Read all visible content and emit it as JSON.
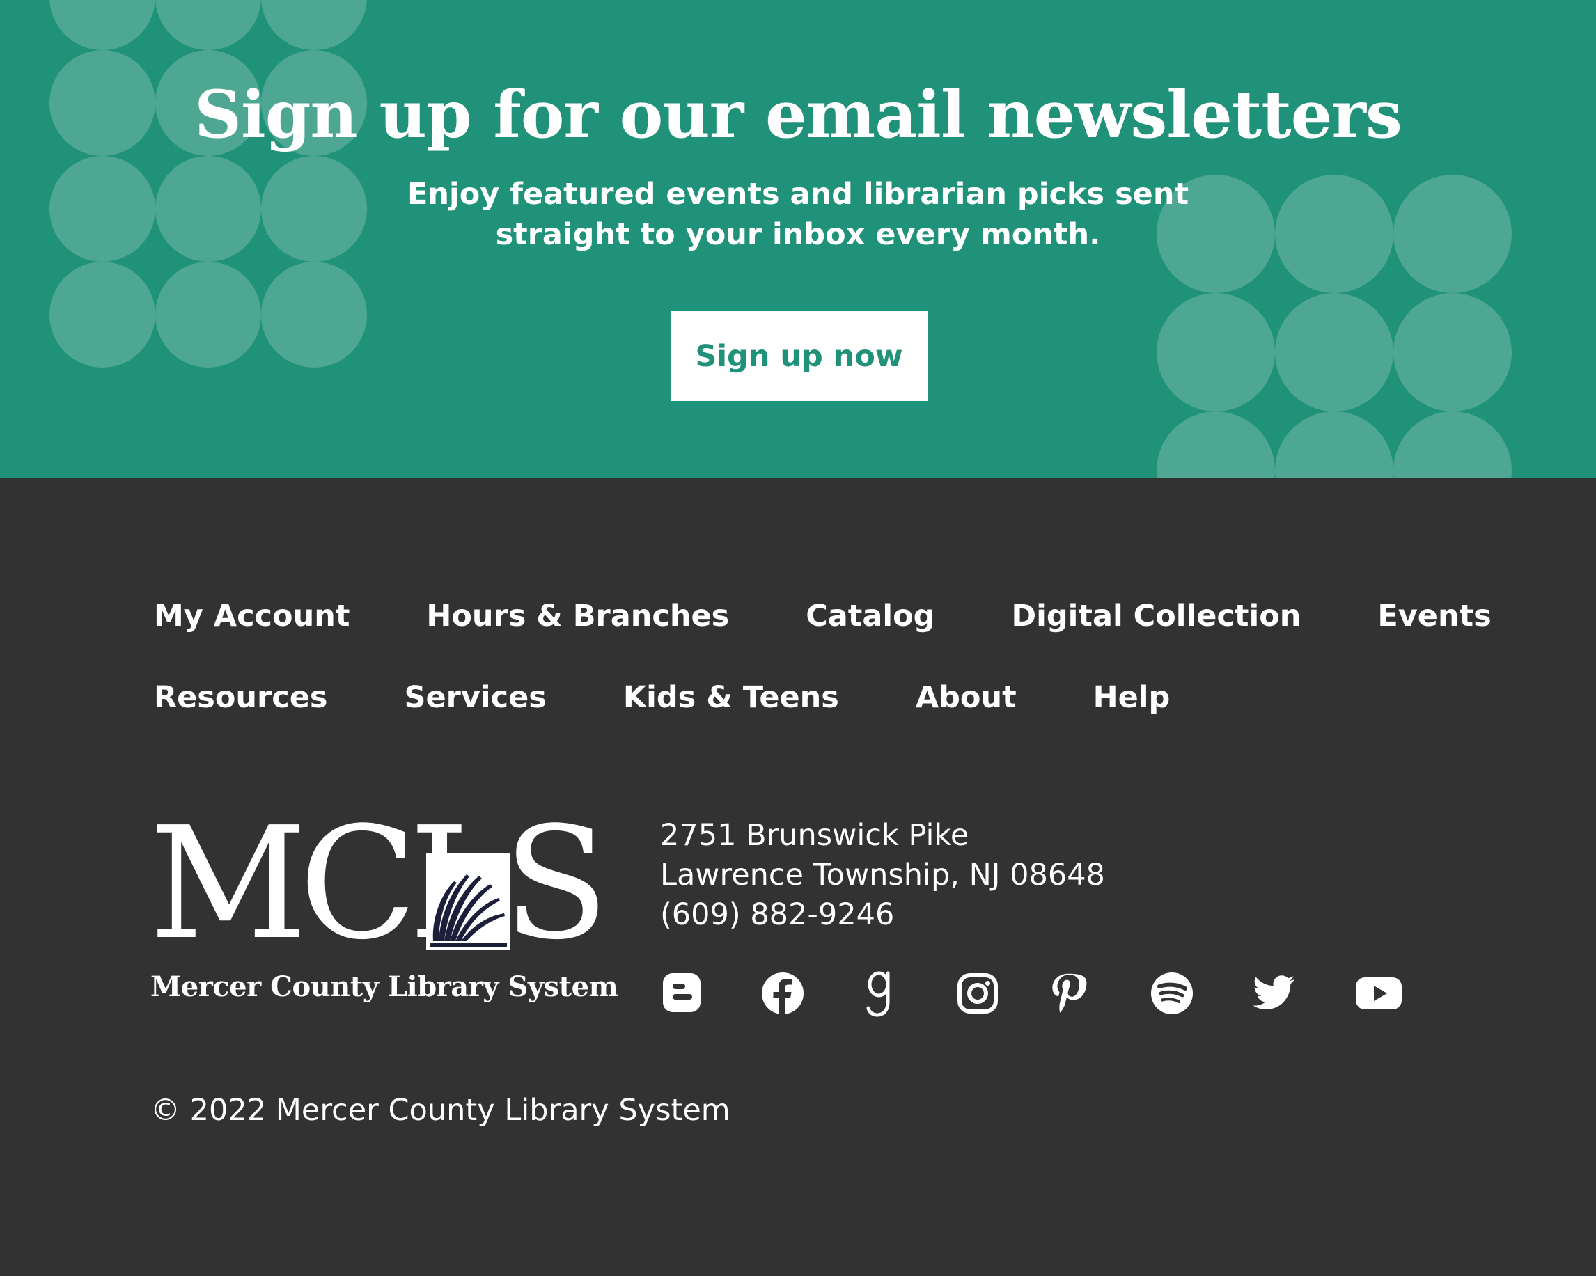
{
  "newsletter": {
    "title": "Sign up for our email newsletters",
    "subtitle_line1": "Enjoy featured events and librarian picks sent",
    "subtitle_line2": "straight to your inbox every month.",
    "button_label": "Sign up now",
    "background_color": "#21927a",
    "dot_color": "#4ea792"
  },
  "footer": {
    "background_color": "#323232",
    "nav_row1": [
      "My Account",
      "Hours & Branches",
      "Catalog",
      "Digital Collection",
      "Events"
    ],
    "nav_row2": [
      "Resources",
      "Services",
      "Kids & Teens",
      "About",
      "Help"
    ],
    "logo": {
      "letters": "MCLS",
      "tagline": "Mercer County Library System"
    },
    "address": {
      "street": "2751 Brunswick Pike",
      "city": "Lawrence Township, NJ 08648",
      "phone": "(609) 882-9246"
    },
    "social_icons": [
      "blogger-icon",
      "facebook-icon",
      "goodreads-icon",
      "instagram-icon",
      "pinterest-icon",
      "spotify-icon",
      "twitter-icon",
      "youtube-icon"
    ],
    "copyright": "© 2022 Mercer County Library System"
  }
}
